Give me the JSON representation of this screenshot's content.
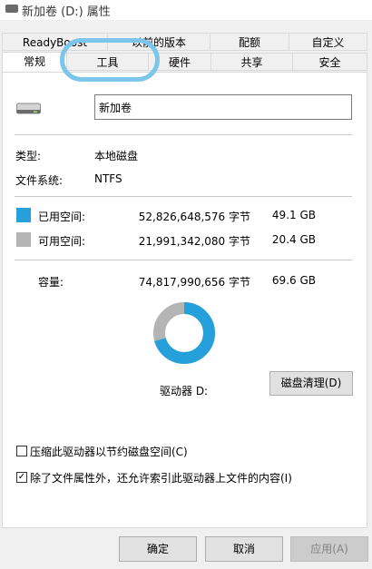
{
  "window": {
    "title": "新加卷 (D:) 属性"
  },
  "tabs_row1": [
    {
      "label": "ReadyBoost"
    },
    {
      "label": "以前的版本"
    },
    {
      "label": "配额"
    },
    {
      "label": "自定义"
    }
  ],
  "tabs_row2": [
    {
      "label": "常规"
    },
    {
      "label": "工具"
    },
    {
      "label": "硬件"
    },
    {
      "label": "共享"
    },
    {
      "label": "安全"
    }
  ],
  "general": {
    "volume_name": "新加卷",
    "type_label": "类型:",
    "type_value": "本地磁盘",
    "fs_label": "文件系统:",
    "fs_value": "NTFS",
    "used": {
      "label": "已用空间:",
      "bytes": "52,826,648,576 字节",
      "size": "49.1 GB",
      "color": "#26a0da"
    },
    "free": {
      "label": "可用空间:",
      "bytes": "21,991,342,080 字节",
      "size": "20.4 GB",
      "color": "#b4b4b4"
    },
    "capacity": {
      "label": "容量:",
      "bytes": "74,817,990,656 字节",
      "size": "69.6 GB"
    },
    "usage_fraction": 0.706,
    "drive_label": "驱动器 D:",
    "cleanup_button": "磁盘清理(D)",
    "compress_label": "压缩此驱动器以节约磁盘空间(C)",
    "compress_checked": false,
    "index_label": "除了文件属性外，还允许索引此驱动器上文件的内容(I)",
    "index_checked": true
  },
  "buttons": {
    "ok": "确定",
    "cancel": "取消",
    "apply": "应用(A)"
  },
  "annotation_color": "#7cc6ec"
}
